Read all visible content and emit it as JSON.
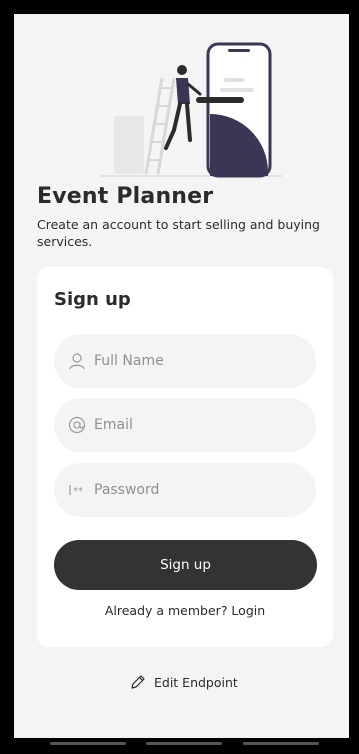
{
  "app": {
    "title": "Event Planner",
    "subtitle": "Create an account to start selling and buying services."
  },
  "form": {
    "title": "Sign up",
    "full_name": {
      "placeholder": "Full Name",
      "value": "",
      "icon": "user-icon"
    },
    "email": {
      "placeholder": "Email",
      "value": "",
      "icon": "at-icon"
    },
    "password": {
      "placeholder": "Password",
      "value": "",
      "icon": "password-icon"
    },
    "submit_label": "Sign up",
    "login_link": "Already a member? Login"
  },
  "footer": {
    "edit_endpoint_label": "Edit Endpoint",
    "edit_icon": "pencil-icon"
  },
  "colors": {
    "background": "#f4f4f4",
    "card": "#ffffff",
    "primary_button": "#333333",
    "text": "#2b2b2b",
    "placeholder": "#8f8f8f",
    "illustration_accent": "#3b3556"
  }
}
